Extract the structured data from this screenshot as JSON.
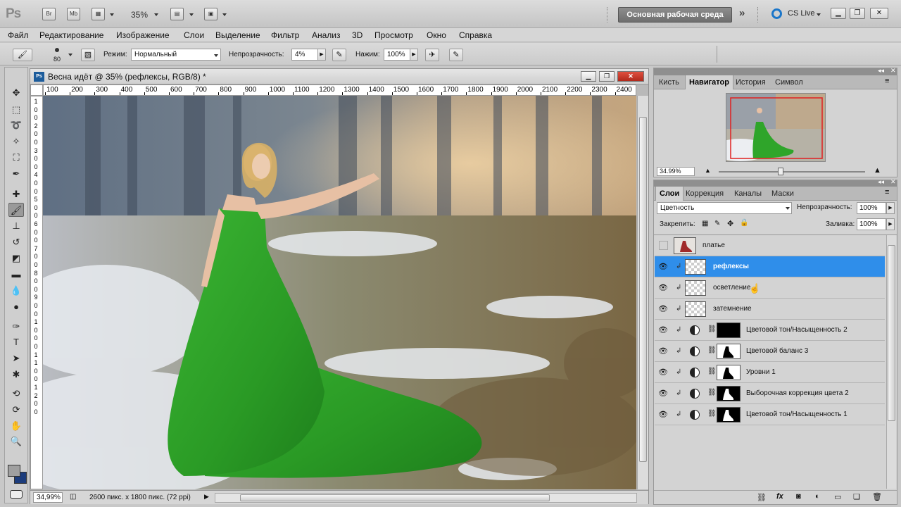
{
  "app": {
    "logo": "Ps",
    "bridge_btn": "Br",
    "minibridge_btn": "Mb",
    "zoom": "35%",
    "workspace": "Основная рабочая среда",
    "cslive": "CS Live"
  },
  "menu": [
    "Файл",
    "Редактирование",
    "Изображение",
    "Слои",
    "Выделение",
    "Фильтр",
    "Анализ",
    "3D",
    "Просмотр",
    "Окно",
    "Справка"
  ],
  "options": {
    "brush_size": "80",
    "mode_label": "Режим:",
    "mode_value": "Нормальный",
    "opacity_label": "Непрозрачность:",
    "opacity_value": "4%",
    "flow_label": "Нажим:",
    "flow_value": "100%"
  },
  "document": {
    "title": "Весна идёт @ 35% (рефлексы, RGB/8) *",
    "ruler_ticks": [
      "100",
      "200",
      "300",
      "400",
      "500",
      "600",
      "700",
      "800",
      "900",
      "1000",
      "1100",
      "1200",
      "1300",
      "1400",
      "1500",
      "1600",
      "1700",
      "1800",
      "1900",
      "2000",
      "2100",
      "2200",
      "2300",
      "2400"
    ],
    "vruler_ticks": [
      "1",
      "0",
      "0",
      "2",
      "0",
      "0",
      "3",
      "0",
      "0",
      "4",
      "0",
      "0",
      "5",
      "0",
      "0",
      "6",
      "0",
      "0",
      "7",
      "0",
      "0",
      "8",
      "0",
      "0",
      "9",
      "0",
      "0",
      "1",
      "0",
      "0",
      "0",
      "1",
      "1",
      "0",
      "0",
      "1",
      "2",
      "0",
      "0"
    ],
    "zoom_status": "34,99%",
    "doc_info": "2600 пикс. x 1800 пикс. (72 ppi)"
  },
  "navigator": {
    "tabs": [
      "Кисть",
      "Навигатор",
      "История",
      "Символ"
    ],
    "active_tab": "Навигатор",
    "zoom": "34.99%"
  },
  "layers_panel": {
    "tabs": [
      "Слои",
      "Коррекция",
      "Каналы",
      "Маски"
    ],
    "active_tab": "Слои",
    "blend_mode": "Цветность",
    "opacity_label": "Непрозрачность:",
    "opacity": "100%",
    "lock_label": "Закрепить:",
    "fill_label": "Заливка:",
    "fill": "100%",
    "layers": [
      {
        "name": "платье",
        "visible": false,
        "selected": false,
        "kind": "image"
      },
      {
        "name": "рефлексы",
        "visible": true,
        "selected": true,
        "kind": "pixel"
      },
      {
        "name": "осветление",
        "visible": true,
        "selected": false,
        "kind": "pixel"
      },
      {
        "name": "затемнение",
        "visible": true,
        "selected": false,
        "kind": "pixel"
      },
      {
        "name": "Цветовой тон/Насыщенность 2",
        "visible": true,
        "selected": false,
        "kind": "adjustment"
      },
      {
        "name": "Цветовой баланс 3",
        "visible": true,
        "selected": false,
        "kind": "adjustment"
      },
      {
        "name": "Уровни 1",
        "visible": true,
        "selected": false,
        "kind": "adjustment"
      },
      {
        "name": "Выборочная коррекция цвета 2",
        "visible": true,
        "selected": false,
        "kind": "adjustment"
      },
      {
        "name": "Цветовой тон/Насыщенность 1",
        "visible": true,
        "selected": false,
        "kind": "adjustment"
      }
    ]
  },
  "colors": {
    "selection": "#2f8eea",
    "dress_green": "#2fa52a",
    "foreground": "#a0a0a0",
    "background": "#1c3c7c"
  }
}
